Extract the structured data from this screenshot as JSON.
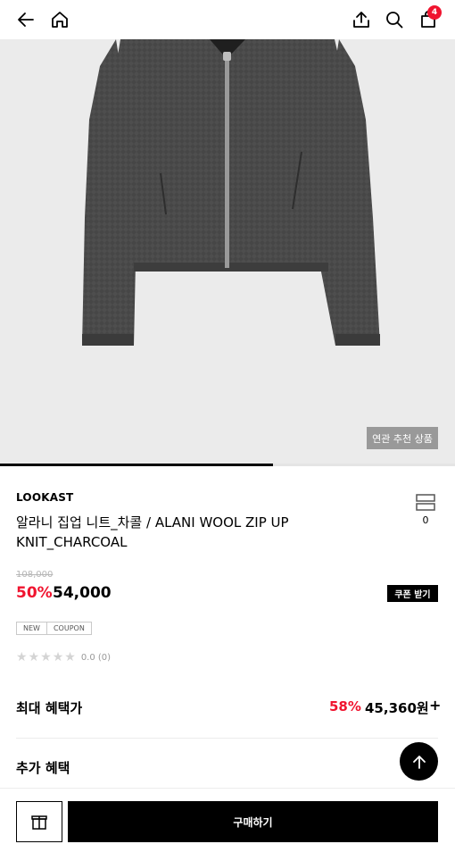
{
  "header": {
    "back_icon": "back-arrow-icon",
    "home_icon": "home-icon",
    "share_icon": "share-icon",
    "search_icon": "search-icon",
    "cart_icon": "shopping-bag-icon",
    "cart_count": "4"
  },
  "gallery": {
    "related_label": "연관 추천 상품",
    "progress": 0.6
  },
  "product": {
    "brand": "LOOKAST",
    "title": "알라니 집업 니트_차콜 / ALANI WOOL ZIP UP KNIT_CHARCOAL",
    "wish_count": "0",
    "original_price": "108,000",
    "discount": "50%",
    "price": "54,000",
    "coupon_label": "쿠폰 받기",
    "tags": [
      "NEW",
      "COUPON"
    ],
    "rating": "0.0 (0)"
  },
  "benefits": {
    "max_label": "최대 혜택가",
    "max_pct": "58%",
    "max_price": "45,360원",
    "plus": "+",
    "extra_label": "추가 혜택"
  },
  "footer": {
    "gift_icon": "gift-icon",
    "buy_label": "구매하기"
  },
  "colors": {
    "accent": "#f0142f",
    "primary": "#000000",
    "hero_bg": "#ebebeb"
  }
}
